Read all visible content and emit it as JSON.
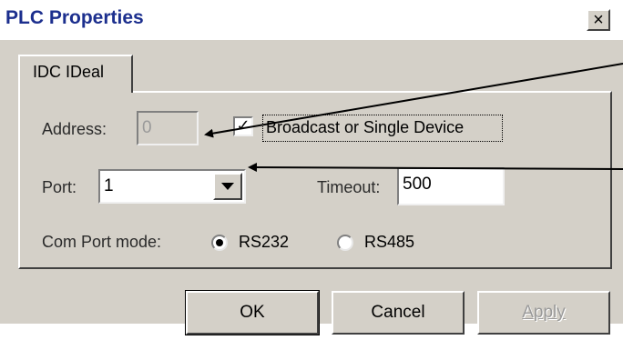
{
  "window": {
    "title": "PLC Properties",
    "close_glyph": "×"
  },
  "tabs": [
    {
      "label": "IDC IDeal"
    }
  ],
  "form": {
    "address_label": "Address:",
    "address_value": "0",
    "broadcast_label": "Broadcast or Single Device",
    "broadcast_checked": true,
    "port_label": "Port:",
    "port_value": "1",
    "timeout_label": "Timeout:",
    "timeout_value": "500",
    "com_mode_label": "Com Port mode:",
    "com_mode_options": [
      {
        "label": "RS232",
        "selected": true
      },
      {
        "label": "RS485",
        "selected": false
      }
    ]
  },
  "buttons": {
    "ok": "OK",
    "cancel": "Cancel",
    "apply": "Apply"
  },
  "icons": {
    "close": "close-icon",
    "dropdown": "chevron-down-icon",
    "check": "checkmark-icon"
  },
  "colors": {
    "title_text": "#1c2f8e",
    "dialog_face": "#d4d0c8",
    "disabled_text": "#9a9a9a"
  }
}
